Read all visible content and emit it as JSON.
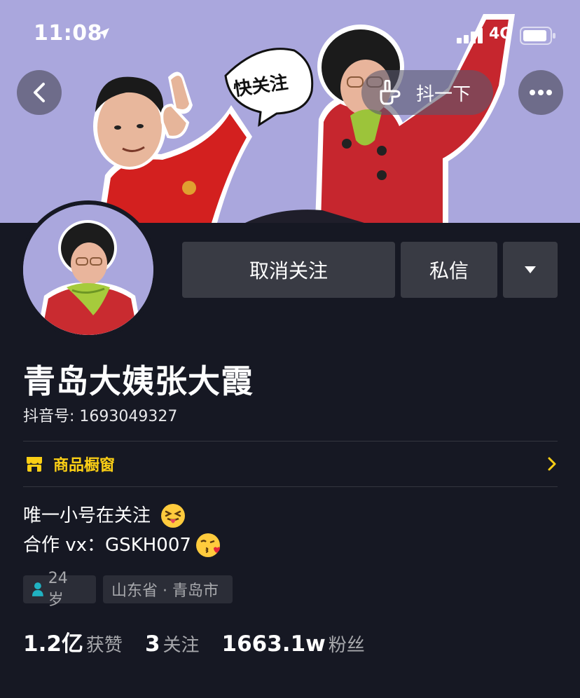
{
  "status_bar": {
    "time": "11:08",
    "network": "4G"
  },
  "banner": {
    "speech_bubble": "快关注"
  },
  "nav": {
    "shake_label": "抖一下"
  },
  "actions": {
    "unfollow_label": "取消关注",
    "message_label": "私信"
  },
  "profile": {
    "name": "青岛大姨张大霞",
    "douyin_id": "抖音号: 1693049327",
    "shop_label": "商品橱窗",
    "bio_line1": "唯一小号在关注",
    "bio_line2": "合作 vx：GSKH007",
    "age_tag": "24 岁",
    "location_tag": "山东省 · 青岛市"
  },
  "stats": [
    {
      "value": "1.2亿",
      "label": "获赞"
    },
    {
      "value": "3",
      "label": "关注"
    },
    {
      "value": "1663.1w",
      "label": "粉丝"
    }
  ],
  "colors": {
    "banner_bg": "#aaa7dd",
    "page_bg": "#161823",
    "accent_yellow": "#face15",
    "button_bg": "#393b44"
  }
}
